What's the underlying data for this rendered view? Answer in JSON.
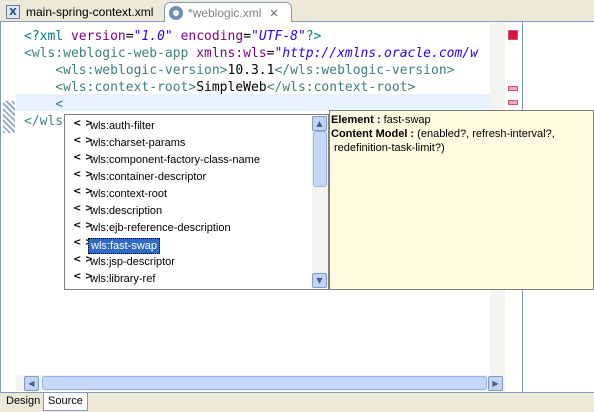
{
  "tabs": [
    {
      "label": "main-spring-context.xml",
      "icon": "xml-file-icon",
      "active": false
    },
    {
      "label": "*weblogic.xml",
      "icon": "xml-editor-icon",
      "active": true
    }
  ],
  "code": {
    "lines": [
      [
        {
          "t": "<?xml ",
          "c": "c-decl"
        },
        {
          "t": "version",
          "c": "c-attr"
        },
        {
          "t": "=",
          "c": "c-text"
        },
        {
          "t": "\"1.0\"",
          "c": "c-str"
        },
        {
          "t": " ",
          "c": "c-text"
        },
        {
          "t": "encoding",
          "c": "c-attr"
        },
        {
          "t": "=",
          "c": "c-text"
        },
        {
          "t": "\"UTF-8\"",
          "c": "c-str"
        },
        {
          "t": "?>",
          "c": "c-decl"
        }
      ],
      [
        {
          "t": "<wls:weblogic-web-app ",
          "c": "c-tag"
        },
        {
          "t": "xmlns:wls",
          "c": "c-attr"
        },
        {
          "t": "=",
          "c": "c-text"
        },
        {
          "t": "\"http://xmlns.oracle.com/w",
          "c": "c-str"
        }
      ],
      [
        {
          "t": "    <wls:weblogic-version>",
          "c": "c-tag"
        },
        {
          "t": "10.3.1",
          "c": "c-text"
        },
        {
          "t": "</wls:weblogic-version>",
          "c": "c-tag"
        }
      ],
      [
        {
          "t": "    <wls:context-root>",
          "c": "c-tag"
        },
        {
          "t": "SimpleWeb",
          "c": "c-text"
        },
        {
          "t": "</wls:context-root>",
          "c": "c-tag"
        }
      ],
      [
        {
          "t": "    <",
          "c": "c-tag"
        }
      ],
      [
        {
          "t": "</wls",
          "c": "c-tag"
        }
      ]
    ]
  },
  "completion": {
    "items": [
      {
        "icon": "< >",
        "label": "wls:auth-filter"
      },
      {
        "icon": "< >",
        "label": "wls:charset-params"
      },
      {
        "icon": "< >",
        "label": "wls:component-factory-class-name"
      },
      {
        "icon": "< >",
        "label": "wls:container-descriptor"
      },
      {
        "icon": "< >",
        "label": "wls:context-root"
      },
      {
        "icon": "< >",
        "label": "wls:description"
      },
      {
        "icon": "< >",
        "label": "wls:ejb-reference-description"
      },
      {
        "icon": "< >",
        "label": "wls:fast-swap"
      },
      {
        "icon": "< >",
        "label": "wls:jsp-descriptor"
      },
      {
        "icon": "< >",
        "label": "wls:library-ref"
      }
    ],
    "selected_index": 7
  },
  "info": {
    "element_label": "Element :",
    "element_value": "fast-swap",
    "content_model_label": "Content Model :",
    "content_model_value_line1": "(enabled?, refresh-interval?,",
    "content_model_value_line2": "redefinition-task-limit?)"
  },
  "bottom_tabs": [
    {
      "label": "Design",
      "active": false
    },
    {
      "label": "Source",
      "active": true
    }
  ],
  "colors": {
    "tag": "#3f7f7f",
    "attribute": "#7f007f",
    "string": "#2a00ff",
    "selection": "#316ac5",
    "info_background": "#fffbe1",
    "current_line": "#e8f2fe"
  }
}
